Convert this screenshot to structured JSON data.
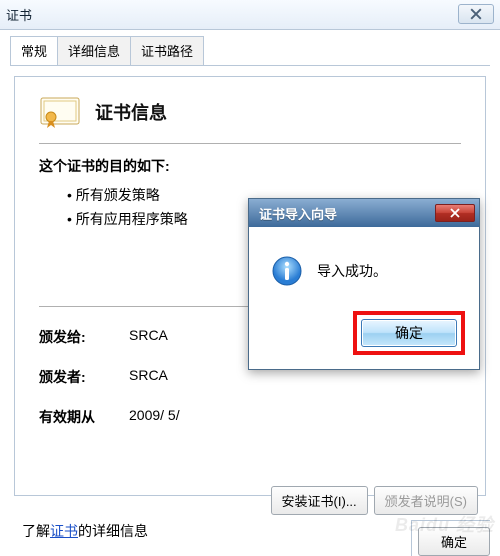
{
  "window": {
    "title": "证书"
  },
  "tabs": [
    "常规",
    "详细信息",
    "证书路径"
  ],
  "activeTab": 0,
  "cert": {
    "heading": "证书信息",
    "purpose_label": "这个证书的目的如下:",
    "purposes": [
      "所有颁发策略",
      "所有应用程序策略"
    ],
    "issued_to_label": "颁发给:",
    "issued_to": "SRCA",
    "issuer_label": "颁发者:",
    "issuer": "SRCA",
    "valid_from_label": "有效期从",
    "valid_from": "2009/ 5/"
  },
  "buttons": {
    "install": "安装证书(I)...",
    "issuer_statement": "颁发者说明(S)",
    "ok": "确定"
  },
  "learn": {
    "prefix": "了解",
    "link": "证书",
    "suffix": "的详细信息"
  },
  "popup": {
    "title": "证书导入向导",
    "message": "导入成功。",
    "ok": "确定"
  }
}
